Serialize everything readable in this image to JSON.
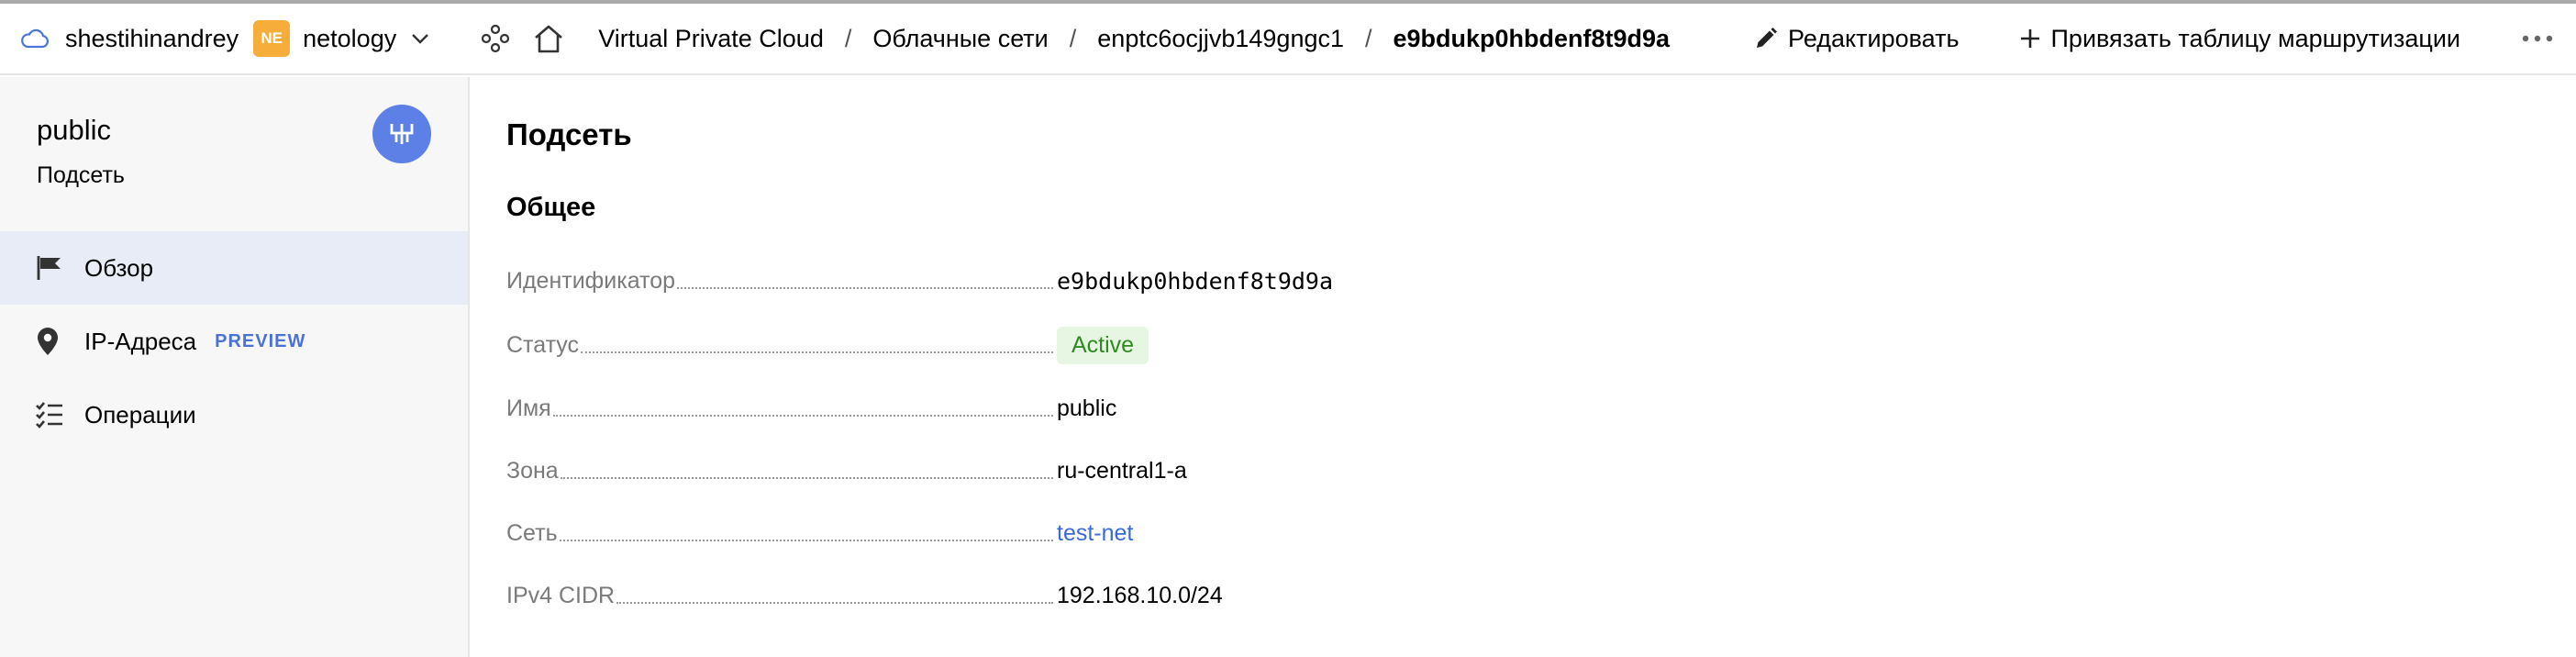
{
  "header": {
    "account": "shestihinandrey",
    "org_badge": "NE",
    "org_name": "netology",
    "breadcrumbs": [
      "Virtual Private Cloud",
      "Облачные сети",
      "enptc6ocjjvb149gngc1",
      "e9bdukp0hbdenf8t9d9a"
    ],
    "breadcrumb_separator": "/",
    "edit_label": "Редактировать",
    "bind_route_table_label": "Привязать таблицу маршрутизации"
  },
  "sidebar": {
    "title": "public",
    "subtitle": "Подсеть",
    "items": [
      {
        "label": "Обзор",
        "icon": "flag-icon",
        "active": true
      },
      {
        "label": "IP-Адреса",
        "icon": "map-pin-icon",
        "badge": "PREVIEW"
      },
      {
        "label": "Операции",
        "icon": "checklist-icon"
      }
    ]
  },
  "main": {
    "title": "Подсеть",
    "section_title": "Общее",
    "fields": [
      {
        "label": "Идентификатор",
        "value": "e9bdukp0hbdenf8t9d9a"
      },
      {
        "label": "Статус",
        "value": "Active"
      },
      {
        "label": "Имя",
        "value": "public"
      },
      {
        "label": "Зона",
        "value": "ru-central1-a"
      },
      {
        "label": "Сеть",
        "value": "test-net"
      },
      {
        "label": "IPv4 CIDR",
        "value": "192.168.10.0/24"
      }
    ]
  },
  "colors": {
    "accent": "#5c80e6",
    "status_bg": "#e7f6e3",
    "status_text": "#2f8a22",
    "link": "#3a6ad9",
    "org_badge": "#f6ad3a"
  }
}
